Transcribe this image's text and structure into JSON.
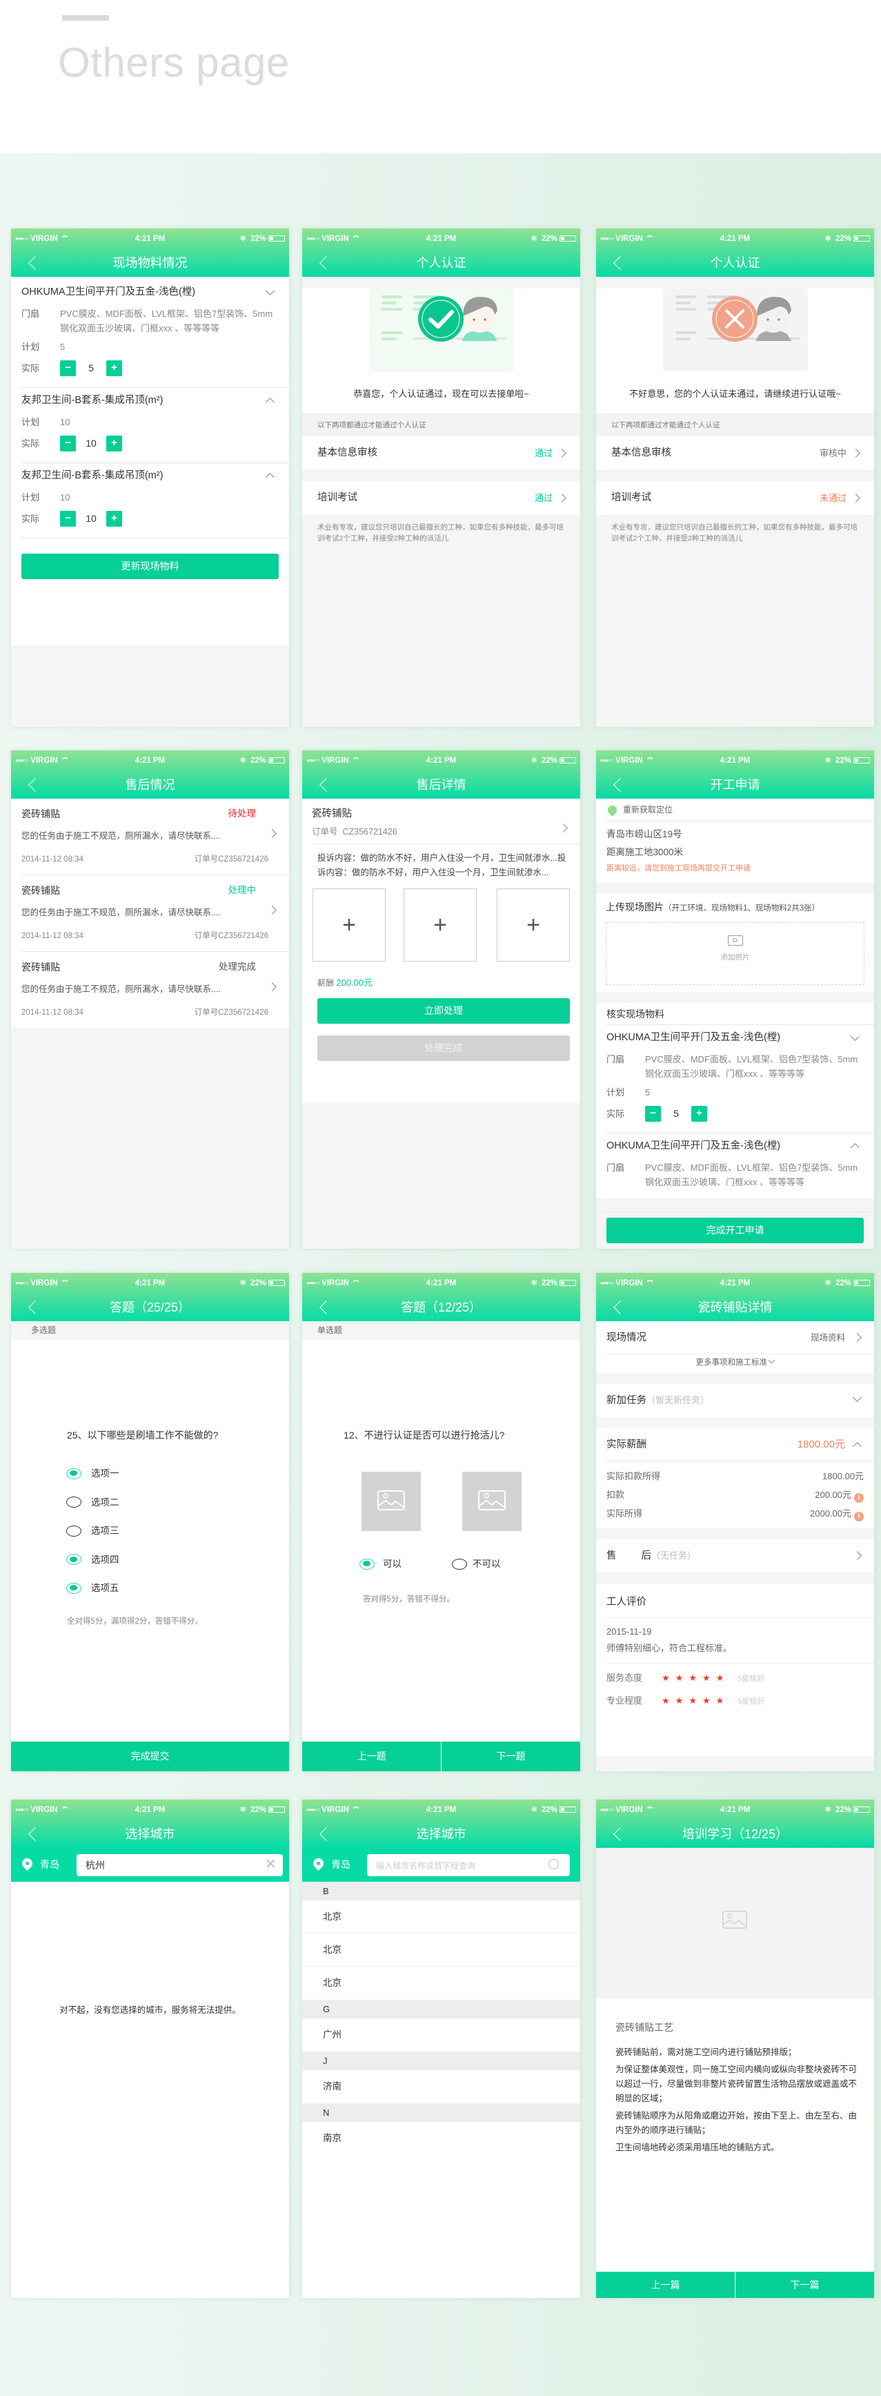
{
  "page": {
    "title": "Others page"
  },
  "status": {
    "carrier": "VIRGIN",
    "time": "4:21 PM",
    "battery": "22%"
  },
  "colors": {
    "accent": "#06cf98",
    "header_top": "#8fe291",
    "header_bottom": "#05dba6",
    "warning": "#f2815e",
    "danger": "#f0262a"
  },
  "materials": {
    "title": "现场物料情况",
    "detail_label": "门扇",
    "plan_label": "计划",
    "actual_label": "实际",
    "items": [
      {
        "name": "OHKUMA卫生间平开门及五金-浅色(樘)",
        "detail": "PVC膜皮、MDF面板、LVL框架、铝色7型装饰、5mm钢化双面玉沙玻璃、门框xxx 、等等等等",
        "plan": "5",
        "actual": "5"
      },
      {
        "name": "友邦卫生间-B套系-集成吊顶(m²)",
        "plan": "10",
        "actual": "10"
      },
      {
        "name": "友邦卫生间-B套系-集成吊顶(m²)",
        "plan": "10",
        "actual": "10"
      }
    ],
    "button": "更新现场物料"
  },
  "cert_pass": {
    "title": "个人认证",
    "message": "恭喜您，个人认证通过，现在可以去接单啦~",
    "note": "以下两项都通过才能通过个人认证",
    "rows": [
      {
        "label": "基本信息审核",
        "status": "通过"
      },
      {
        "label": "培训考试",
        "status": "通过"
      }
    ],
    "footer": "术业有专攻，建议您只培训自己最擅长的工种，如果您有多种技能，最多可培训考试2个工种，并接受2种工种的派活儿"
  },
  "cert_fail": {
    "title": "个人认证",
    "message": "不好意思，您的个人认证未通过，请继续进行认证哦~",
    "note": "以下两项都通过才能通过个人认证",
    "rows": [
      {
        "label": "基本信息审核",
        "status": "审核中"
      },
      {
        "label": "培训考试",
        "status": "未通过"
      }
    ],
    "footer": "术业有专攻，建议您只培训自己最擅长的工种，如果您有多种技能，最多可培训考试2个工种，并接受2种工种的派活儿"
  },
  "aftersales": {
    "title": "售后情况",
    "items": [
      {
        "name": "瓷砖铺贴",
        "status": "待处理",
        "desc": "您的任务由于施工不规范，厕所漏水，请尽快联系....",
        "date": "2014-11-12 08:34",
        "order": "订单号CZ356721426"
      },
      {
        "name": "瓷砖铺贴",
        "status": "处理中",
        "desc": "您的任务由于施工不规范，厕所漏水，请尽快联系....",
        "date": "2014-11-12 08:34",
        "order": "订单号CZ356721426"
      },
      {
        "name": "瓷砖铺贴",
        "status": "处理完成",
        "desc": "您的任务由于施工不规范，厕所漏水，请尽快联系....",
        "date": "2014-11-12 08:34",
        "order": "订单号CZ356721426"
      }
    ]
  },
  "aftersale_detail": {
    "title": "售后详情",
    "name": "瓷砖铺贴",
    "order_label": "订单号",
    "order": "CZ356721426",
    "complaint": "投诉内容：做的防水不好，用户入住没一个月，卫生间就渗水...投诉内容：做的防水不好，用户入住没一个月，卫生间就渗水...",
    "salary_label": "薪酬",
    "salary": "200.00元",
    "primary_button": "立即处理",
    "disabled_button": "处理完成"
  },
  "start_work": {
    "title": "开工申请",
    "relocate": "重新获取定位",
    "address": "青岛市崂山区19号",
    "distance": "距离施工地3000米",
    "warning": "距离较远，请您到施工现场再提交开工申请",
    "upload_title": "上传现场图片",
    "upload_hint": "（开工环境、现场物料1、现场物料2共3张）",
    "add_photo": "添加照片",
    "verify_title": "核实现场物料",
    "detail_label": "门扇",
    "plan_label": "计划",
    "actual_label": "实际",
    "items": [
      {
        "name": "OHKUMA卫生间平开门及五金-浅色(樘)",
        "detail": "PVC膜皮、MDF面板、LVL框架、铝色7型装饰、5mm钢化双面玉沙玻璃、门框xxx 、等等等等",
        "plan": "5",
        "actual": "5"
      },
      {
        "name": "OHKUMA卫生间平开门及五金-浅色(樘)",
        "detail": "PVC膜皮、MDF面板、LVL框架、铝色7型装饰、5mm钢化双面玉沙玻璃、门框xxx 、等等等等"
      }
    ],
    "button": "完成开工申请"
  },
  "quiz_multi": {
    "title": "答题（25/25）",
    "type": "多选题",
    "question": "25、以下哪些是刷墙工作不能做的?",
    "options": [
      {
        "label": "选项一",
        "checked": true
      },
      {
        "label": "选项二",
        "checked": false
      },
      {
        "label": "选项三",
        "checked": false
      },
      {
        "label": "选项四",
        "checked": true
      },
      {
        "label": "选项五",
        "checked": true
      }
    ],
    "scoring": "全对得5分，漏项得2分，答错不得分。",
    "submit": "完成提交"
  },
  "quiz_single": {
    "title": "答题（12/25）",
    "type": "单选题",
    "question": "12、不进行认证是否可以进行抢活儿?",
    "options": [
      {
        "label": "可以",
        "checked": true
      },
      {
        "label": "不可以",
        "checked": false
      }
    ],
    "scoring": "答对得5分，答错不得分。",
    "prev": "上一题",
    "next": "下一题"
  },
  "tile_detail": {
    "title": "瓷砖铺贴详情",
    "site": "现场情况",
    "site_link": "现场资料",
    "more": "更多事项和施工标准",
    "new_task": "新加任务",
    "new_task_sub": "（暂无新任务）",
    "pay_label": "实际薪酬",
    "pay": "1800.00元",
    "pay_rows": [
      {
        "label": "实际扣款所得",
        "value": "1800.00元"
      },
      {
        "label": "扣款",
        "value": "200.00元"
      },
      {
        "label": "实际所得",
        "value": "2000.00元"
      }
    ],
    "after_a": "售",
    "after_b": "后",
    "after_sub": "（无任务）",
    "review_title": "工人评价",
    "review_date": "2015-11-19",
    "review_text": "师傅特别细心，符合工程标准。",
    "ratings": [
      {
        "label": "服务态度",
        "stars": 5,
        "text": "5星极好"
      },
      {
        "label": "专业程度",
        "stars": 5,
        "text": "5星极好"
      }
    ]
  },
  "city_empty": {
    "title": "选择城市",
    "current": "青岛",
    "search_value": "杭州",
    "message": "对不起，没有您选择的城市，服务将无法提供。"
  },
  "city_list": {
    "title": "选择城市",
    "current": "青岛",
    "placeholder": "输入城市名称或首字母查询",
    "groups": [
      {
        "letter": "B",
        "cities": [
          "北京",
          "北京",
          "北京"
        ]
      },
      {
        "letter": "G",
        "cities": [
          "广州"
        ]
      },
      {
        "letter": "J",
        "cities": [
          "济南"
        ]
      },
      {
        "letter": "N",
        "cities": [
          "南京"
        ]
      }
    ]
  },
  "training": {
    "title": "培训学习（12/25）",
    "heading": "瓷砖铺贴工艺",
    "paragraphs": [
      "瓷砖铺贴前，需对施工空间内进行铺贴预排版；",
      "为保证整体美观性，同一施工空间内横向或纵向非整块瓷砖不可以超过一行，尽量做到非整片瓷砖留置生活物品摆放或遮盖或不明显的区域；",
      "瓷砖铺贴顺序为从阳角或磨边开始，按由下至上、由左至右、由内至外的顺序进行铺贴；",
      "卫生间墙地砖必须采用墙压地的铺贴方式。"
    ],
    "prev": "上一篇",
    "next": "下一篇"
  }
}
